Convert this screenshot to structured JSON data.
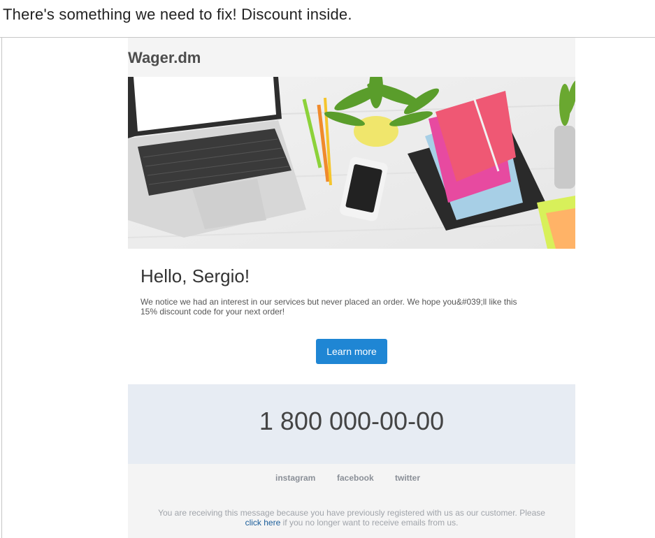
{
  "subject": "There's something we need to fix! Discount inside.",
  "email": {
    "brand": "Wager.dm",
    "greeting": "Hello, Sergio!",
    "body_line1": "We notice we had an interest in our services but never placed an order. We hope you&#039;ll like this",
    "body_line2": "15% discount code for your next order!",
    "cta_label": "Learn more",
    "phone": "1 800 000-00-00",
    "social": {
      "instagram": "instagram",
      "facebook": "facebook",
      "twitter": "twitter"
    },
    "footer": {
      "line1": "You are receiving this message because you have previously registered with us as our customer. Please",
      "link_text": "click here",
      "line2_rest": "if you no longer want to receive emails from us."
    }
  },
  "colors": {
    "cta": "#1f86d4",
    "header_bg": "#f4f4f4",
    "phone_band_bg": "#e7ecf3",
    "link": "#1a5d9a"
  },
  "icons": [
    "hero-desk-image"
  ]
}
